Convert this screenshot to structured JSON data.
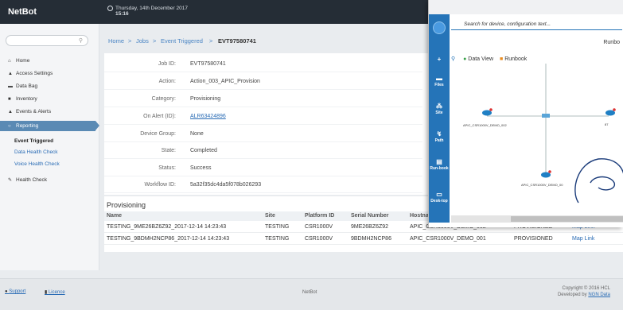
{
  "header": {
    "brand": "NetBot",
    "date": "Thursday, 14th December 2017",
    "time": "15:16"
  },
  "sidebar": {
    "search_placeholder": "",
    "items": [
      {
        "label": "Home",
        "icon": "home-icon"
      },
      {
        "label": "Access Settings",
        "icon": "lock-icon"
      },
      {
        "label": "Data Bag",
        "icon": "briefcase-icon"
      },
      {
        "label": "Inventory",
        "icon": "printer-icon"
      },
      {
        "label": "Events & Alerts",
        "icon": "bell-icon"
      },
      {
        "label": "Reporting",
        "icon": "circle-icon"
      }
    ],
    "subitems": [
      "Event Triggered",
      "Data Health Check",
      "Voice Health Check"
    ],
    "after": {
      "label": "Health Check",
      "icon": "wrench-icon"
    }
  },
  "breadcrumb": {
    "home": "Home",
    "jobs": "Jobs",
    "event": "Event Triggered",
    "current": "EVT97580741",
    "sep": ">"
  },
  "details": [
    {
      "key": "Job ID:",
      "value": "EVT97580741"
    },
    {
      "key": "Action:",
      "value": "Action_003_APIC_Provision"
    },
    {
      "key": "Category:",
      "value": "Provisioning"
    },
    {
      "key": "On Alert (ID):",
      "value": "ALR63424896"
    },
    {
      "key": "Device Group:",
      "value": "None"
    },
    {
      "key": "State:",
      "value": "Completed"
    },
    {
      "key": "Status:",
      "value": "Success"
    },
    {
      "key": "Workflow ID:",
      "value": "5a32f35dc4da5f078b026293"
    }
  ],
  "provisioning": {
    "title": "Provisioning",
    "columns": [
      "Name",
      "Site",
      "Platform ID",
      "Serial Number",
      "Hostna",
      "",
      ""
    ],
    "rows": [
      [
        "TESTING_9ME26BZ6Z92_2017-12-14 14:23:43",
        "TESTING",
        "CSR1000V",
        "9ME26BZ6Z92",
        "APIC_CSR1000V_DEMO_002",
        "PROVISIONED",
        "Map Link"
      ],
      [
        "TESTING_9BDMH2NCP86_2017-12-14 14:23:43",
        "TESTING",
        "CSR1000V",
        "9BDMH2NCP86",
        "APIC_CSR1000V_DEMO_001",
        "PROVISIONED",
        "Map Link"
      ]
    ]
  },
  "footer": {
    "support": "Support",
    "licence": "Licence",
    "center": "NetBot",
    "copyright": "Copyright © 2016 HCL",
    "developed": "Developed by",
    "developer": "NGN Data"
  },
  "popup": {
    "url": "",
    "search_placeholder": "Search for device, configuration text...",
    "nav": [
      {
        "label": "",
        "icon": "plus-icon"
      },
      {
        "label": "Files",
        "icon": "folder-icon"
      },
      {
        "label": "Site",
        "icon": "sitemap-icon"
      },
      {
        "label": "Path",
        "icon": "path-icon"
      },
      {
        "label": "Run-book",
        "icon": "book-icon"
      },
      {
        "label": "Desk-top",
        "icon": "monitor-icon"
      }
    ],
    "data_view": "Data View",
    "runbook": "Runbook",
    "runbook_right": "Runbo",
    "device_left": "APIC_CSR1000V_DEMO_002",
    "device_bottom": "APIC_CSR1000V_DEMO_00",
    "device_right": "87"
  }
}
